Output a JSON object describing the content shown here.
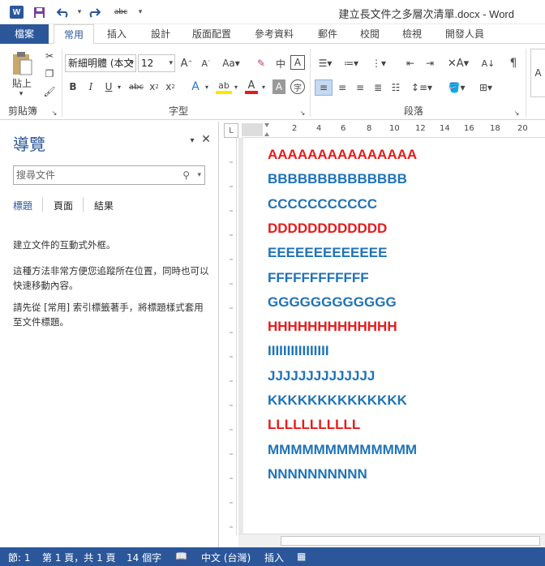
{
  "title_bar": {
    "title": "建立長文件之多層次清單.docx - Word",
    "app_badge": "W"
  },
  "tabs": [
    "檔案",
    "常用",
    "插入",
    "設計",
    "版面配置",
    "參考資料",
    "郵件",
    "校閱",
    "檢視",
    "開發人員"
  ],
  "ribbon": {
    "clipboard": {
      "paste_label": "貼上",
      "group_label": "剪貼簿"
    },
    "font": {
      "font_name": "新細明體 (本文",
      "font_size": "12",
      "group_label": "字型"
    },
    "paragraph": {
      "group_label": "段落"
    }
  },
  "nav_pane": {
    "title": "導覽",
    "search_placeholder": "搜尋文件",
    "tabs": [
      "標題",
      "頁面",
      "結果"
    ],
    "help_1": "建立文件的互動式外框。",
    "help_2": "這種方法非常方便您追蹤所在位置，同時也可以快速移動內容。",
    "help_3": "請先從 [常用] 索引標籤著手，將標題樣式套用至文件標題。"
  },
  "ruler": {
    "labels": [
      "2",
      "4",
      "6",
      "8",
      "10",
      "12",
      "14",
      "16",
      "18",
      "20"
    ]
  },
  "document": {
    "lines": [
      {
        "text": "AAAAAAAAAAAAAAA",
        "color": "#e81a1a"
      },
      {
        "text": "BBBBBBBBBBBBBB",
        "color": "#1f73b7"
      },
      {
        "text": "CCCCCCCCCCC",
        "color": "#1f73b7"
      },
      {
        "text": "DDDDDDDDDDDD",
        "color": "#e81a1a"
      },
      {
        "text": "EEEEEEEEEEEEE",
        "color": "#1f73b7"
      },
      {
        "text": "FFFFFFFFFFFF",
        "color": "#1f73b7"
      },
      {
        "text": "GGGGGGGGGGGG",
        "color": "#1f73b7"
      },
      {
        "text": "HHHHHHHHHHHHH",
        "color": "#e81a1a"
      },
      {
        "text": "IIIIIIIIIIIIIIII",
        "color": "#1f73b7"
      },
      {
        "text": "JJJJJJJJJJJJJJ",
        "color": "#1f73b7"
      },
      {
        "text": "KKKKKKKKKKKKKK",
        "color": "#1f73b7"
      },
      {
        "text": "LLLLLLLLLLL",
        "color": "#e81a1a"
      },
      {
        "text": "MMMMMMMMMMMMM",
        "color": "#1f73b7"
      },
      {
        "text": "NNNNNNNNNN",
        "color": "#1f73b7"
      }
    ]
  },
  "status_bar": {
    "section": "節: 1",
    "page": "第 1 頁，共 1 頁",
    "words": "14 個字",
    "language": "中文 (台灣)",
    "mode": "插入"
  },
  "colors": {
    "accent": "#2b579a",
    "red": "#e81a1a",
    "blue": "#1f73b7"
  }
}
